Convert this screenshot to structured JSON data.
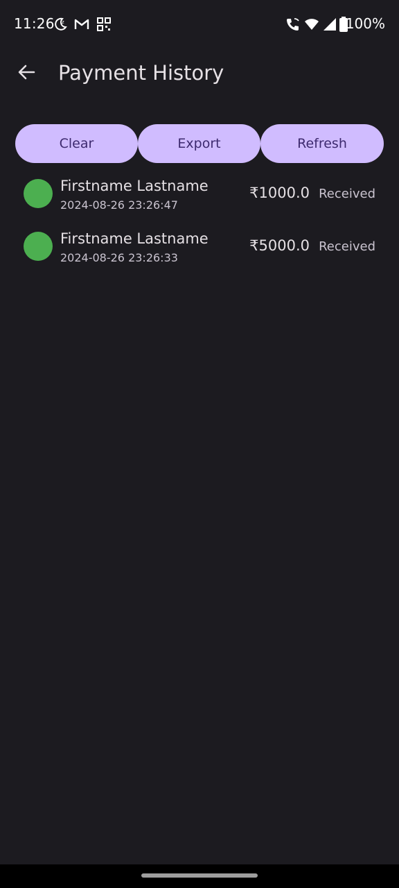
{
  "status_bar": {
    "time": "11:26",
    "battery": "100%",
    "icons": [
      "moon-icon",
      "gmail-icon",
      "qr-icon",
      "wifi-calling-icon",
      "wifi-icon",
      "signal-icon",
      "battery-icon"
    ]
  },
  "header": {
    "title": "Payment History",
    "back_icon": "arrow-back-icon"
  },
  "actions": {
    "clear_label": "Clear",
    "export_label": "Export",
    "refresh_label": "Refresh"
  },
  "transactions": [
    {
      "name": "Firstname Lastname",
      "date": "2024-08-26 23:26:47",
      "amount": "₹1000.0",
      "status": "Received"
    },
    {
      "name": "Firstname Lastname",
      "date": "2024-08-26 23:26:33",
      "amount": "₹5000.0",
      "status": "Received"
    }
  ],
  "colors": {
    "background": "#1c1b20",
    "button": "#d0bcff",
    "button_text": "#3d2a6e",
    "status_dot": "#4caf50"
  }
}
